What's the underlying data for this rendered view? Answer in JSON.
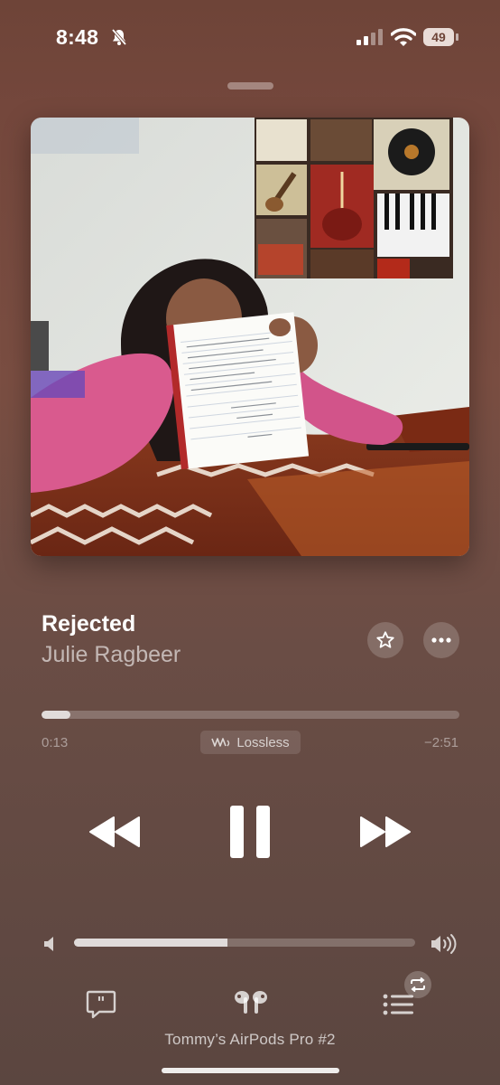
{
  "status_bar": {
    "time": "8:48",
    "battery": "49",
    "icons": [
      "bell-slash-icon",
      "cellular-signal-icon",
      "wifi-icon",
      "battery-icon"
    ]
  },
  "now_playing": {
    "title": "Rejected",
    "artist": "Julie Ragbeer",
    "elapsed": "0:13",
    "remaining": "−2:51",
    "progress": 0.07,
    "quality_badge": "Lossless",
    "volume": 0.45
  },
  "controls": {
    "icons": [
      "favorite-star-icon",
      "more-options-icon",
      "rewind-icon",
      "pause-icon",
      "fast-forward-icon",
      "volume-low-icon",
      "volume-high-icon",
      "lyrics-icon",
      "airpods-icon",
      "queue-icon",
      "repeat-icon"
    ]
  },
  "output_device": "Tommy’s AirPods Pro #2",
  "colors": {
    "background_top": "#6e4438",
    "background_bottom": "#5b4640",
    "accent": "#ffffff"
  }
}
